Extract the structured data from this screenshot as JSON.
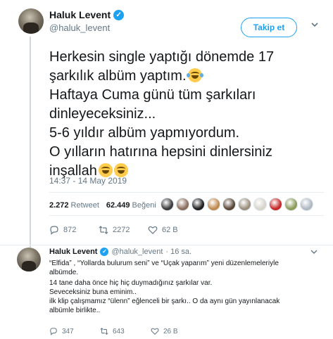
{
  "tweet": {
    "author_name": "Haluk Levent",
    "author_handle": "@haluk_levent",
    "follow_label": "Takip et",
    "lines": [
      "Herkesin single yaptığı dönemde 17",
      "şarkılık albüm yaptım.",
      "Haftaya Cuma günü tüm şarkıları",
      "dinleyeceksiniz...",
      "5-6 yıldır albüm yapmıyordum.",
      "O yılların hatırına hepsini dinlersiniz",
      "inşallah"
    ],
    "timestamp": "14:37 - 14 May 2019",
    "retweet_count": "2.272",
    "retweet_label": "Retweet",
    "like_count": "62.449",
    "like_label": "Beğeni",
    "liker_colors": [
      "#3b3b3b",
      "#8a6d5a",
      "#1f1f1f",
      "#c08a4e",
      "#5a4636",
      "#9b8e7e",
      "#d8d4cc",
      "#c62828",
      "#8c9c5a",
      "#b0b8c2"
    ],
    "replies": "872",
    "retweets": "2272",
    "likes": "62 B"
  },
  "reply": {
    "author_name": "Haluk Levent",
    "author_handle": "@haluk_levent",
    "time": "· 16 sa.",
    "lines": [
      "“Elfida” , “Yollarda bulurum seni” ve   “Uçak yaparım” yeni düzenlemeleriyle",
      "albümde.",
      "14 tane daha önce hiç hiç duymadığınız şarkılar var.",
      "Seveceksiniz buna eminim..",
      "ilk klip çalışmamız  “ülenn” eğlenceli bir şarkı.. O da aynı gün yayınlanacak",
      "albümle birlikte.."
    ],
    "replies": "347",
    "retweets": "643",
    "likes": "26 B"
  },
  "colors": {
    "accent": "#1da1f2",
    "muted": "#657786",
    "text": "#14171a"
  }
}
